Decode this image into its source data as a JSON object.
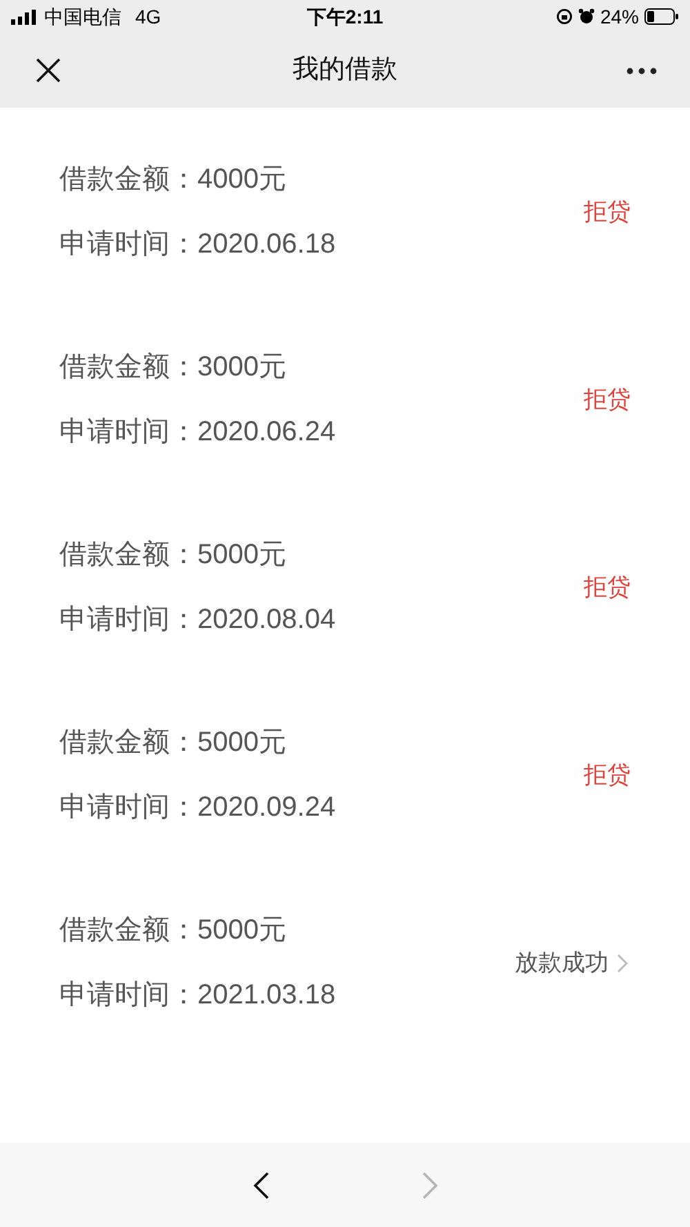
{
  "status_bar": {
    "carrier": "中国电信",
    "network": "4G",
    "time": "下午2:11",
    "battery": "24%"
  },
  "nav": {
    "title": "我的借款"
  },
  "loans": [
    {
      "amount": "借款金额：4000元",
      "date": "申请时间：2020.06.18",
      "status": "拒贷",
      "kind": "rejected"
    },
    {
      "amount": "借款金额：3000元",
      "date": "申请时间：2020.06.24",
      "status": "拒贷",
      "kind": "rejected"
    },
    {
      "amount": "借款金额：5000元",
      "date": "申请时间：2020.08.04",
      "status": "拒贷",
      "kind": "rejected"
    },
    {
      "amount": "借款金额：5000元",
      "date": "申请时间：2020.09.24",
      "status": "拒贷",
      "kind": "rejected"
    },
    {
      "amount": "借款金额：5000元",
      "date": "申请时间：2021.03.18",
      "status": "放款成功",
      "kind": "success"
    }
  ],
  "bottom_bar": {
    "back_disabled": false,
    "forward_disabled": true
  }
}
